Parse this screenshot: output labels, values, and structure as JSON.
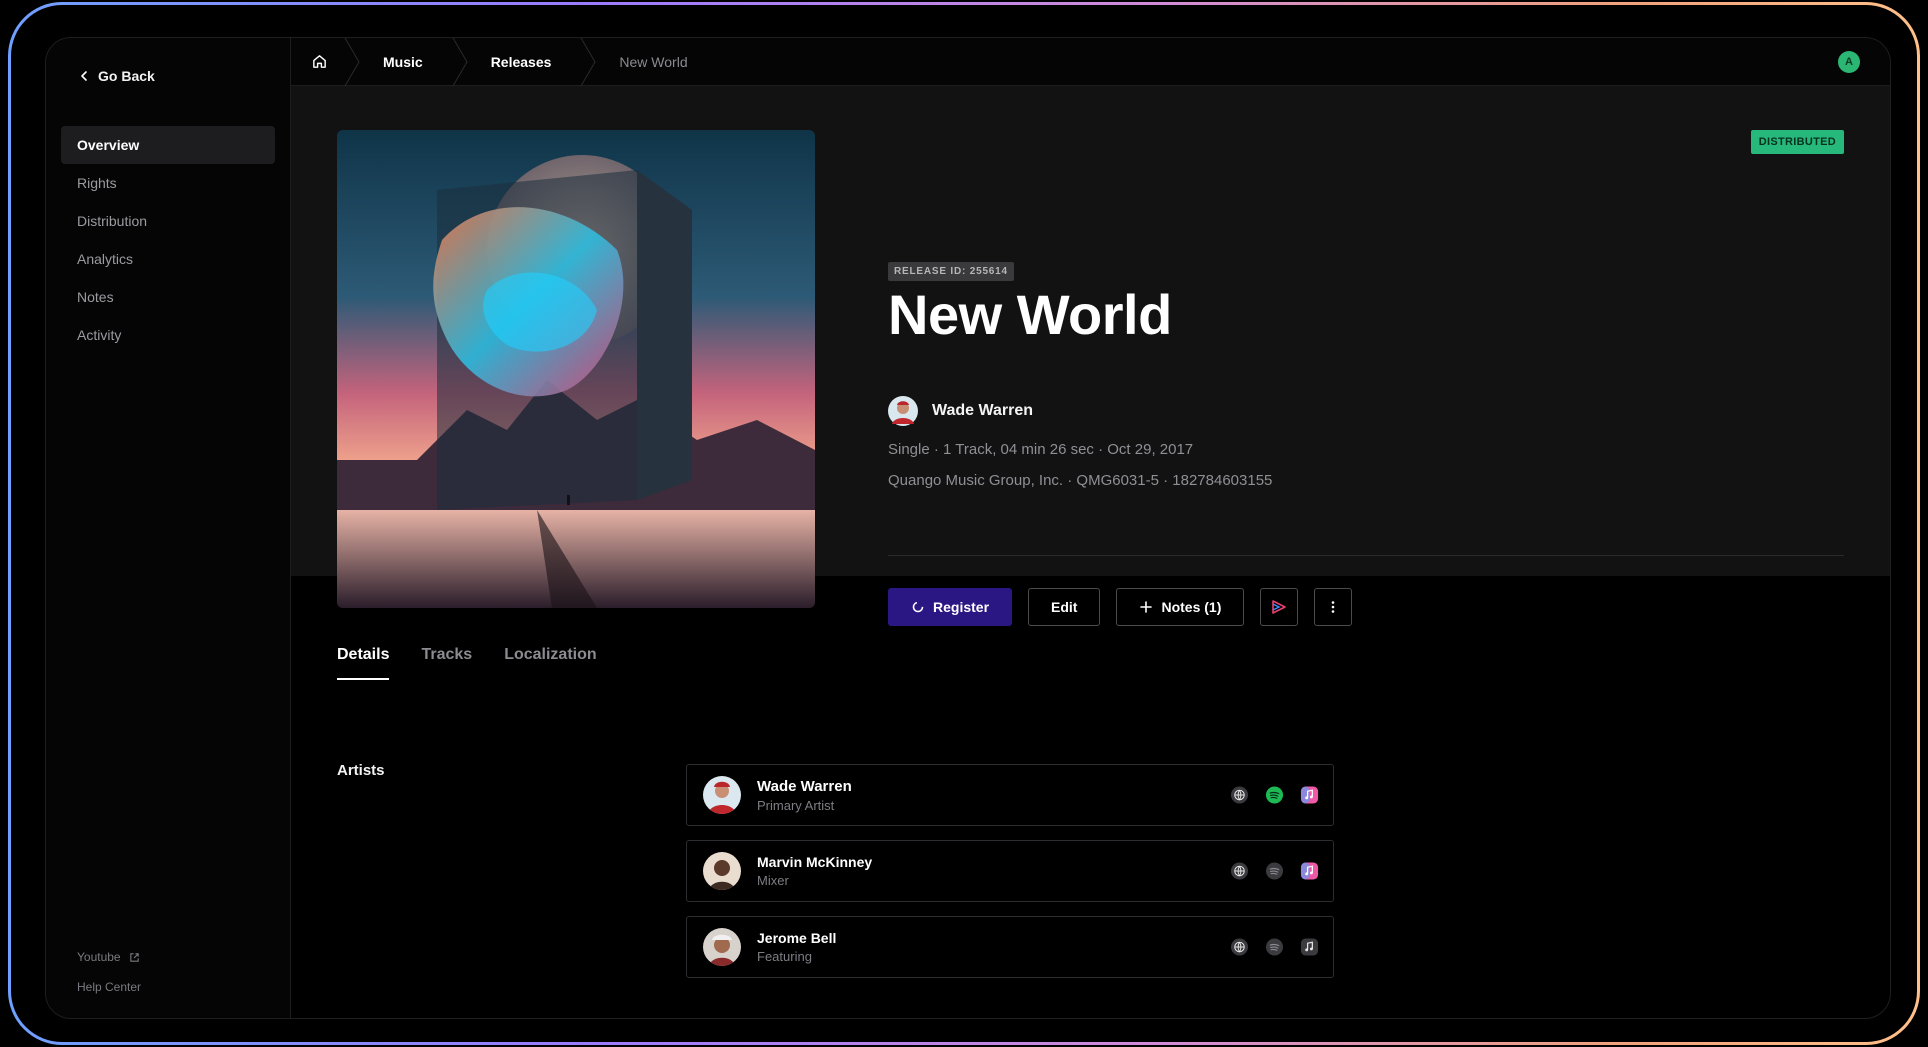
{
  "sidebar": {
    "go_back": "Go Back",
    "items": [
      {
        "label": "Overview",
        "active": true
      },
      {
        "label": "Rights"
      },
      {
        "label": "Distribution"
      },
      {
        "label": "Analytics"
      },
      {
        "label": "Notes"
      },
      {
        "label": "Activity"
      }
    ],
    "footer": {
      "youtube": "Youtube",
      "help": "Help Center"
    }
  },
  "breadcrumb": {
    "home_icon": "home-icon",
    "items": [
      "Music",
      "Releases"
    ],
    "current": "New World"
  },
  "user": {
    "initial": "A",
    "color": "#2bb673"
  },
  "release": {
    "status": "DISTRIBUTED",
    "release_id": "RELEASE ID: 255614",
    "title": "New World",
    "artist": "Wade Warren",
    "meta_line1": "Single · 1 Track, 04 min 26 sec · Oct 29, 2017",
    "meta_line2": "Quango Music Group, Inc. · QMG6031-5 · 182784603155"
  },
  "actions": {
    "register": "Register",
    "edit": "Edit",
    "notes": "Notes (1)",
    "play_icon": "youtube-music-icon",
    "more_icon": "more-vertical-icon"
  },
  "tabs": [
    "Details",
    "Tracks",
    "Localization"
  ],
  "active_tab": "Details",
  "artists_section": {
    "label": "Artists",
    "artists": [
      {
        "name": "Wade Warren",
        "role": "Primary Artist",
        "spotify_active": true,
        "apple_active": true
      },
      {
        "name": "Marvin McKinney",
        "role": "Mixer",
        "spotify_active": false,
        "apple_active": true
      },
      {
        "name": "Jerome Bell",
        "role": "Featuring",
        "spotify_active": false,
        "apple_active": false
      }
    ]
  },
  "colors": {
    "accent": "#2b1783",
    "status_green": "#27b97c",
    "spotify_green": "#1db954",
    "background": "#121212"
  }
}
